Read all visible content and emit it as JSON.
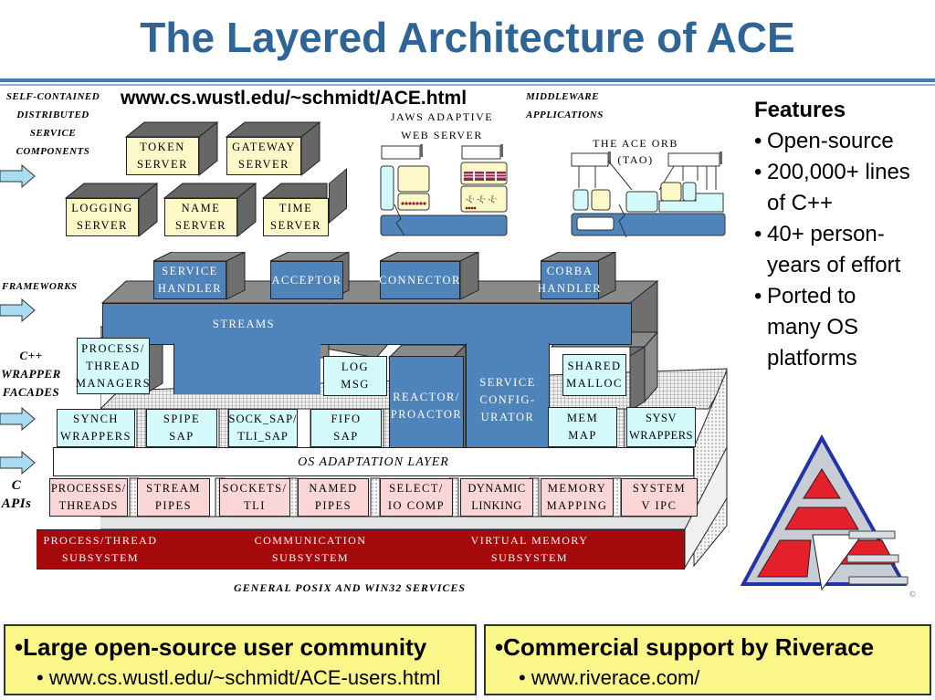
{
  "title": "The Layered Architecture of ACE",
  "url": "www.cs.wustl.edu/~schmidt/ACE.html",
  "layer_labels": {
    "service_components": [
      "SELF-CONTAINED",
      "DISTRIBUTED",
      "SERVICE",
      "COMPONENTS"
    ],
    "middleware": [
      "MIDDLEWARE",
      "APPLICATIONS"
    ],
    "frameworks": "FRAMEWORKS",
    "wrappers": [
      "C++",
      "WRAPPER",
      "FACADES"
    ],
    "c_apis": [
      "C",
      "APIs"
    ],
    "os_adaptation": "OS ADAPTATION LAYER",
    "general_services": "GENERAL POSIX AND WIN32 SERVICES"
  },
  "service_components": [
    "TOKEN\nSERVER",
    "GATEWAY\nSERVER",
    "LOGGING\nSERVER",
    "NAME\nSERVER",
    "TIME\nSERVER"
  ],
  "middleware_apps": {
    "jaws": [
      "JAWS ADAPTIVE",
      "WEB SERVER"
    ],
    "tao": [
      "THE ACE ORB",
      "(TAO)"
    ]
  },
  "frameworks": [
    "SERVICE\nHANDLER",
    "ACCEPTOR",
    "CONNECTOR",
    "CORBA\nHANDLER"
  ],
  "streams": "STREAMS",
  "service_configurator": "SERVICE\nCONFIG-\nURATOR",
  "reactor": "REACTOR/\nPROACTOR",
  "wrappers_upper": [
    "PROCESS/\nTHREAD\nMANAGERS",
    "LOG\nMSG",
    "SHARED\nMALLOC"
  ],
  "wrappers_lower": [
    "SYNCH\nWRAPPERS",
    "SPIPE\nSAP",
    "SOCK_SAP/\nTLI_SAP",
    "FIFO\nSAP",
    "MEM\nMAP",
    "SYSV\nWRAPPERS"
  ],
  "c_apis": [
    "PROCESSES/\nTHREADS",
    "STREAM\nPIPES",
    "SOCKETS/\nTLI",
    "NAMED\nPIPES",
    "SELECT/\nIO COMP",
    "DYNAMIC\nLINKING",
    "MEMORY\nMAPPING",
    "SYSTEM\nV IPC"
  ],
  "subsystems": [
    "PROCESS/THREAD\nSUBSYSTEM",
    "COMMUNICATION\nSUBSYSTEM",
    "VIRTUAL MEMORY\nSUBSYSTEM"
  ],
  "features": {
    "heading": "Features",
    "items": [
      "Open-source",
      "200,000+ lines of C++",
      "40+ person-years of effort",
      "Ported to many OS platforms"
    ]
  },
  "footer": {
    "left": {
      "headline": "Large open-source user community",
      "link": "www.cs.wustl.edu/~schmidt/ACE-users.html"
    },
    "right": {
      "headline": "Commercial support by Riverace",
      "link": "www.riverace.com/"
    }
  },
  "logo": {
    "name": "ace-logo",
    "copyright": "©"
  },
  "colors": {
    "title": "#2f6496",
    "framework_blue": "#4f84bb",
    "subsystem_red": "#a50a0a",
    "component_yellow": "#fdf8c8",
    "wrapper_cyan": "#d4fafc",
    "api_pink": "#fbd6d6",
    "footer_yellow": "#fbf68a"
  }
}
